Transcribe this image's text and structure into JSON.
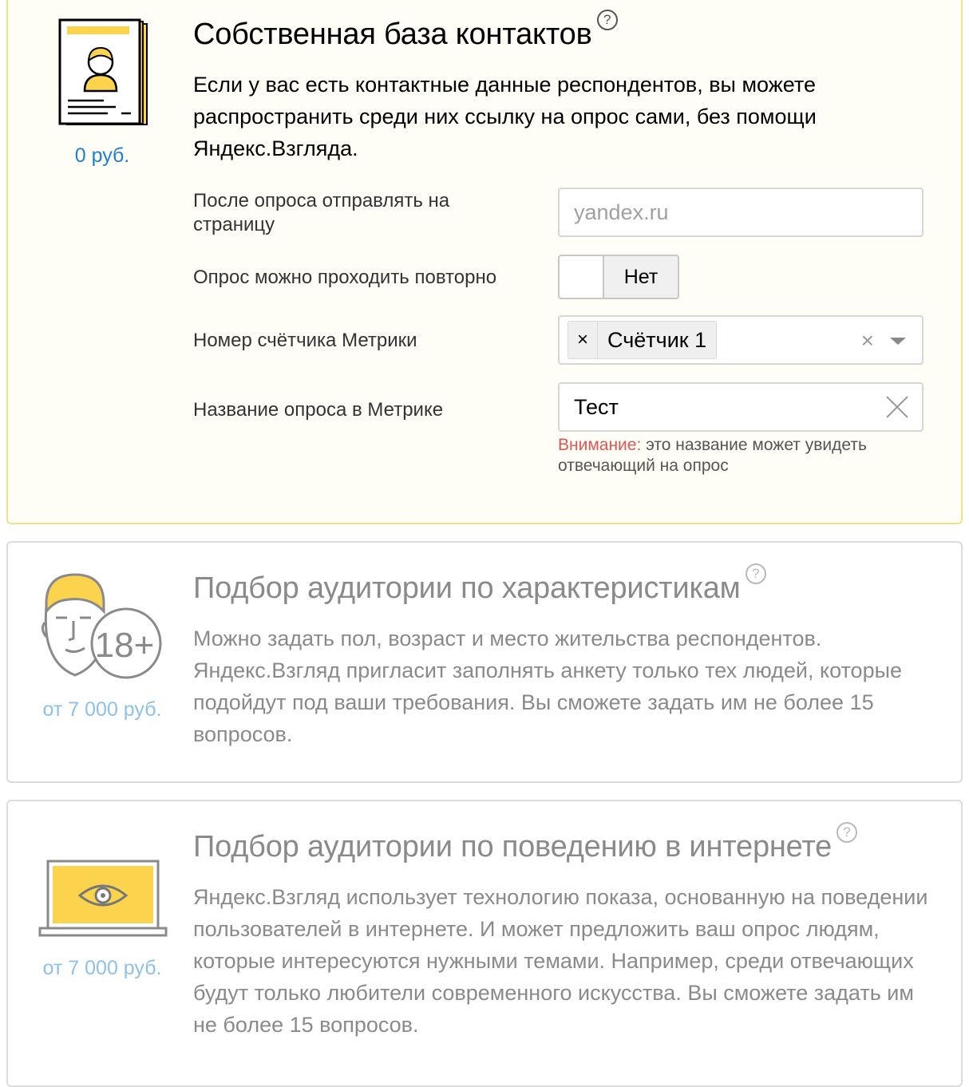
{
  "colors": {
    "accent_yellow": "#fcd34d",
    "selected_border": "#ebe48a",
    "price_active": "#1f7ed6",
    "price_inactive": "#8dc1ea",
    "warning_red": "#e05555"
  },
  "options": [
    {
      "title": "Собственная база контактов",
      "help": "?",
      "price": "0 руб.",
      "description": "Если у вас есть контактные данные респондентов, вы можете распространить среди них ссылку на опрос сами, без помощи Яндекс.Взгляда.",
      "icon": "document-person-icon",
      "selected": true
    },
    {
      "title": "Подбор аудитории по характеристикам",
      "help": "?",
      "price": "от 7 000 руб.",
      "description": "Можно задать пол, возраст и место жительства респондентов. Яндекс.Взгляд пригласит заполнять анкету только тех людей, которые подойдут под ваши требования. Вы сможете задать им не более 15 вопросов.",
      "icon": "person-18plus-icon",
      "icon_badge": "18+",
      "selected": false
    },
    {
      "title": "Подбор аудитории по поведению в интернете",
      "help": "?",
      "price": "от 7 000 руб.",
      "description": "Яндекс.Взгляд использует технологию показа, основанную на поведении пользователей в интернете. И может предложить ваш опрос людям, которые интересуются нужными темами. Например, среди отвечающих будут только любители современного искусства. Вы сможете задать им не более 15 вопросов.",
      "icon": "laptop-eye-icon",
      "selected": false
    }
  ],
  "settings": {
    "redirect": {
      "label": "После опроса отправлять на страницу",
      "value": "",
      "placeholder": "yandex.ru"
    },
    "repeat": {
      "label": "Опрос можно проходить повторно",
      "value": "Нет"
    },
    "counter": {
      "label": "Номер счётчика Метрики",
      "chip_remove": "×",
      "chip_label": "Счётчик 1",
      "clear": "×"
    },
    "metrika_name": {
      "label": "Название опроса в Метрике",
      "value": "Тест",
      "warning_label": "Внимание:",
      "warning_text": " это название может увидеть отвечающий на опрос"
    }
  }
}
